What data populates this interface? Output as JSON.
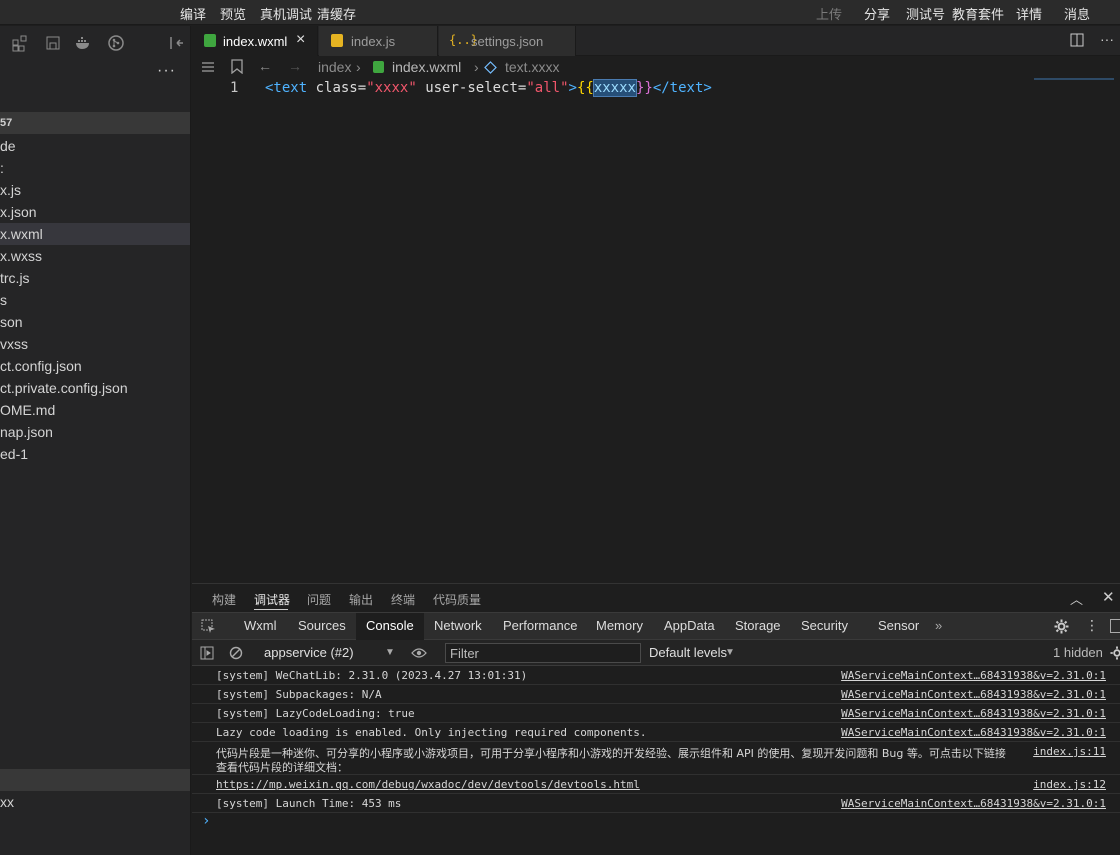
{
  "menu": {
    "items": [
      "编译",
      "预览",
      "真机调试",
      "清缓存"
    ],
    "right_items": [
      "上传",
      "分享",
      "测试号",
      "教育套件",
      "详情",
      "消息"
    ]
  },
  "sidebar": {
    "section_label": "57",
    "files": [
      "de",
      ":",
      "x.js",
      "x.json",
      "x.wxml",
      "x.wxss",
      "trc.js",
      "s",
      "son",
      "vxss",
      "ct.config.json",
      "ct.private.config.json",
      "OME.md",
      "nap.json",
      "ed-1"
    ],
    "selected_index": 4,
    "outline_item": "xx"
  },
  "tabs": [
    {
      "label": "index.wxml",
      "active": true,
      "icon": "wxml-file-icon"
    },
    {
      "label": "index.js",
      "active": false,
      "icon": "js-file-icon"
    },
    {
      "label": "settings.json",
      "active": false,
      "icon": "json-file-icon"
    }
  ],
  "breadcrumb": [
    "index",
    "index.wxml",
    "text.xxxx"
  ],
  "editor": {
    "line_number": "1",
    "tokens": {
      "open": "<text",
      "attr1": "class",
      "eq1": "=",
      "val1": "\"xxxx\"",
      "attr2": "user-select",
      "eq2": "=",
      "val2": "\"all\"",
      "gt": ">",
      "brace_open": "{{",
      "expr": "xxxxx",
      "brace_close": "}}",
      "close": "</text>"
    }
  },
  "panel": {
    "tabs": [
      "构建",
      "调试器",
      "问题",
      "输出",
      "终端",
      "代码质量"
    ],
    "active_tab": "调试器",
    "devtools_tabs": [
      "Wxml",
      "Sources",
      "Console",
      "Network",
      "Performance",
      "Memory",
      "AppData",
      "Storage",
      "Security",
      "Sensor"
    ],
    "active_devtools_tab": "Console",
    "context": "appservice (#2)",
    "filter_placeholder": "Filter",
    "levels": "Default levels",
    "hidden": "1 hidden",
    "prompt": "›",
    "messages": [
      {
        "text": "[system] WeChatLib: 2.31.0 (2023.4.27 13:01:31)",
        "source": "WAServiceMainContext…68431938&v=2.31.0:1"
      },
      {
        "text": "[system] Subpackages: N/A",
        "source": "WAServiceMainContext…68431938&v=2.31.0:1"
      },
      {
        "text": "[system] LazyCodeLoading: true",
        "source": "WAServiceMainContext…68431938&v=2.31.0:1"
      },
      {
        "text": "Lazy code loading is enabled. Only injecting required components.",
        "source": "WAServiceMainContext…68431938&v=2.31.0:1"
      },
      {
        "text": "代码片段是一种迷你、可分享的小程序或小游戏项目，可用于分享小程序和小游戏的开发经验、展示组件和 API 的使用、复现开发问题和 Bug 等。可点击以下链接",
        "text2": "查看代码片段的详细文档：",
        "source": "index.js:11"
      },
      {
        "text": "https://mp.weixin.qq.com/debug/wxadoc/dev/devtools/devtools.html",
        "source": "index.js:12",
        "link": true
      },
      {
        "text": "[system] Launch Time: 453 ms",
        "source": "WAServiceMainContext…68431938&v=2.31.0:1"
      }
    ]
  },
  "colors": {
    "tag": "#4fb3ff",
    "attr": "#dcdcdc",
    "string": "#f0566b",
    "brace": "#ffd700",
    "expr": "#9cdcfe",
    "close_brace": "#da70d6"
  }
}
